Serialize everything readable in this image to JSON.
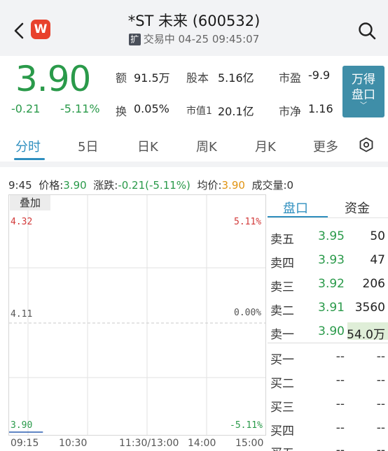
{
  "header": {
    "logo_letter": "W",
    "title": "*ST 未来 (600532)",
    "status_tag": "扩",
    "status_text": "交易中 04-25 09:45:07"
  },
  "quote": {
    "price": "3.90",
    "change": "-0.21",
    "change_pct": "-5.11%",
    "stats": [
      {
        "label": "额",
        "value": "91.5万"
      },
      {
        "label": "股本",
        "value": "5.16亿"
      },
      {
        "label": "市盈",
        "value": "-9.9"
      },
      {
        "label": "换",
        "value": "0.05%"
      },
      {
        "label": "市值1",
        "value": "20.1亿"
      },
      {
        "label": "市净",
        "value": "1.16"
      }
    ],
    "wande_line1": "万得",
    "wande_line2": "盘口",
    "wande_chevron": "﹀"
  },
  "tabs": [
    "分时",
    "5日",
    "日K",
    "周K",
    "月K",
    "更多"
  ],
  "active_tab": "分时",
  "info_line": {
    "time": "9:45",
    "price_label": "价格:",
    "price": "3.90",
    "change_label": "涨跌:",
    "change": "-0.21(-5.11%)",
    "avg_label": "均价:",
    "avg": "3.90",
    "vol_label": "成交量:",
    "vol": "0"
  },
  "chart": {
    "overlay_label": "叠加",
    "y_left": [
      "4.32",
      "4.11",
      "3.90"
    ],
    "y_right": [
      "5.11%",
      "0.00%",
      "-5.11%"
    ],
    "x_labels": [
      "09:15",
      "10:30",
      "11:30/13:00",
      "14:00",
      "15:00"
    ],
    "colors": {
      "up": "#d23a3a",
      "down": "#2a9a4a",
      "neutral": "#555555"
    }
  },
  "chart_data": {
    "type": "line",
    "title": "",
    "xlabel": "",
    "ylabel": "",
    "x": [
      "09:15",
      "09:45"
    ],
    "series": [
      {
        "values": [
          3.9,
          3.9
        ]
      }
    ],
    "ylim": [
      3.9,
      4.32
    ],
    "prev_close": 4.11,
    "x_ticks": [
      "09:15",
      "10:30",
      "11:30/13:00",
      "14:00",
      "15:00"
    ]
  },
  "order_book": {
    "tabs": [
      "盘口",
      "资金"
    ],
    "asks": [
      {
        "label": "卖五",
        "price": "3.95",
        "volume": "50"
      },
      {
        "label": "卖四",
        "price": "3.93",
        "volume": "47"
      },
      {
        "label": "卖三",
        "price": "3.92",
        "volume": "206"
      },
      {
        "label": "卖二",
        "price": "3.91",
        "volume": "3560"
      },
      {
        "label": "卖一",
        "price": "3.90",
        "volume": "54.0万"
      }
    ],
    "bids": [
      {
        "label": "买一",
        "price": "--",
        "volume": "--"
      },
      {
        "label": "买二",
        "price": "--",
        "volume": "--"
      },
      {
        "label": "买三",
        "price": "--",
        "volume": "--"
      },
      {
        "label": "买四",
        "price": "--",
        "volume": "--"
      },
      {
        "label": "买五",
        "price": "--",
        "volume": "--"
      }
    ]
  }
}
